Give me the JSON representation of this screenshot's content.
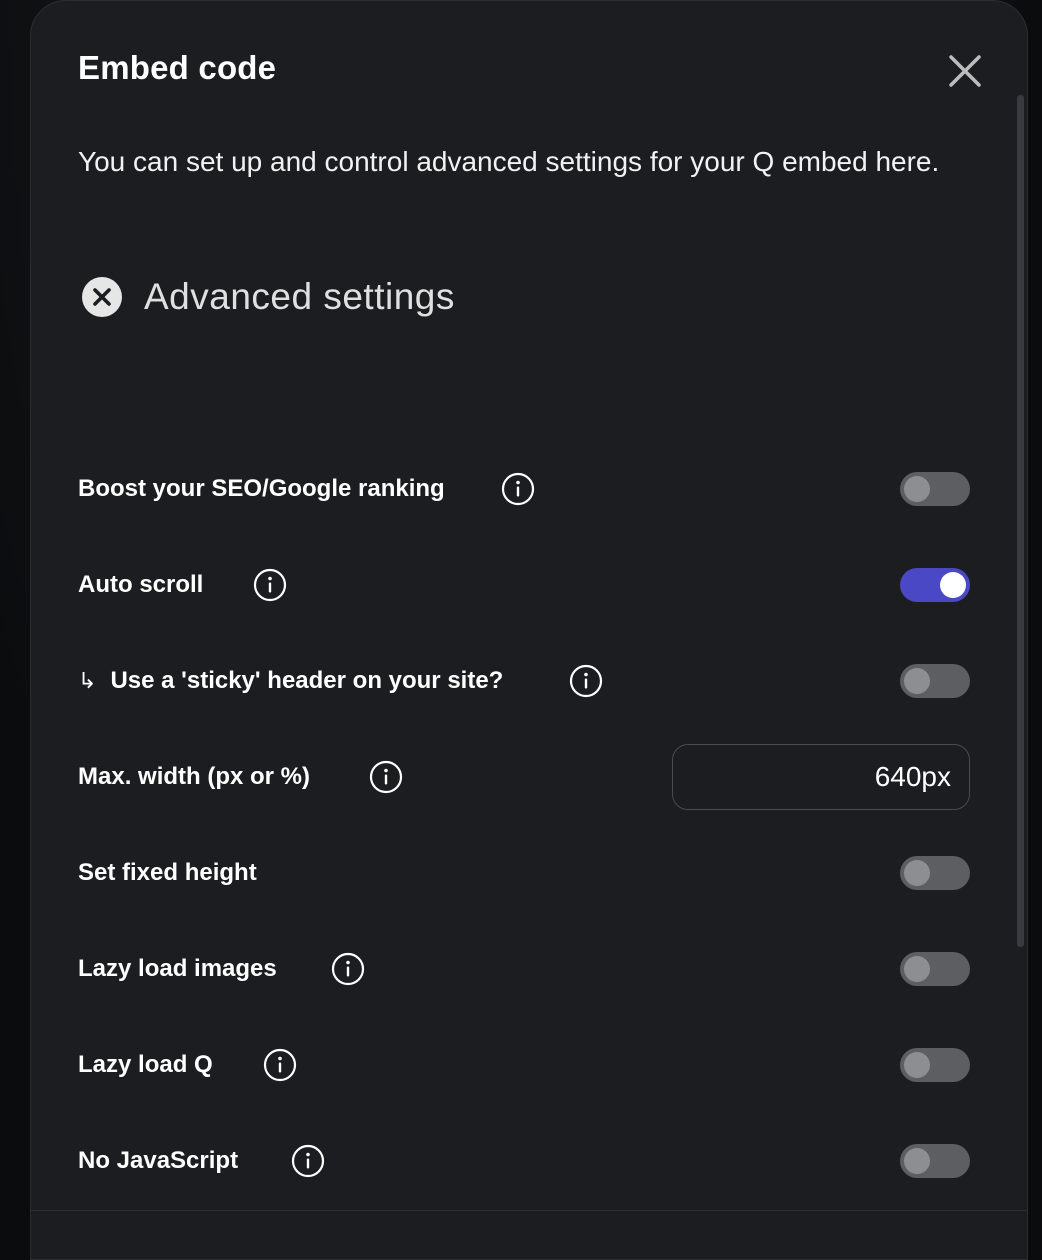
{
  "modal": {
    "title": "Embed code",
    "intro": "You can set up and control advanced settings for your Q embed here.",
    "advanced_label": "Advanced settings"
  },
  "settings": [
    {
      "label": "Boost your SEO/Google ranking",
      "info": true,
      "control": "toggle",
      "state": "off"
    },
    {
      "label": "Auto scroll",
      "info": true,
      "control": "toggle",
      "state": "on"
    },
    {
      "label": "Use a 'sticky' header on your site?",
      "prefix": "↳",
      "info": true,
      "control": "toggle",
      "state": "off"
    },
    {
      "label": "Max. width (px or %)",
      "info": true,
      "control": "input",
      "value": "640px"
    },
    {
      "label": "Set fixed height",
      "info": false,
      "control": "toggle",
      "state": "off"
    },
    {
      "label": "Lazy load images",
      "info": true,
      "control": "toggle",
      "state": "off"
    },
    {
      "label": "Lazy load Q",
      "info": true,
      "control": "toggle",
      "state": "off"
    },
    {
      "label": "No JavaScript",
      "info": true,
      "control": "toggle",
      "state": "off"
    }
  ],
  "icons": {
    "close": "close-icon",
    "advanced": "close-circle-icon",
    "info": "info-icon",
    "arrow": "return-arrow-icon"
  },
  "colors": {
    "modal_bg": "#1c1d21",
    "toggle_on": "#4a48c4",
    "toggle_off": "#5d5e62"
  }
}
